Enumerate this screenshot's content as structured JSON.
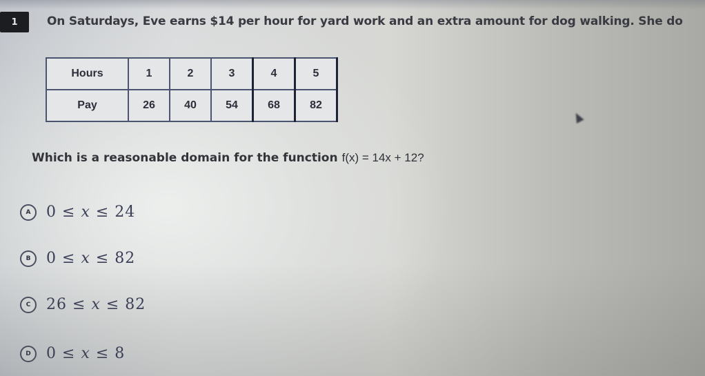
{
  "question": {
    "number": "1",
    "prompt": "On Saturdays, Eve earns $14 per hour for yard work and an extra amount for dog walking. She do",
    "question_text": "Which is a reasonable domain for the function",
    "function_text": "f(x) = 14x + 12?"
  },
  "table": {
    "rows": [
      {
        "label": "Hours",
        "values": [
          "1",
          "2",
          "3",
          "4",
          "5"
        ]
      },
      {
        "label": "Pay",
        "values": [
          "26",
          "40",
          "54",
          "68",
          "82"
        ]
      }
    ]
  },
  "choices": [
    {
      "letter": "A",
      "lower": "0",
      "variable": "x",
      "upper": "24"
    },
    {
      "letter": "B",
      "lower": "0",
      "variable": "x",
      "upper": "82"
    },
    {
      "letter": "C",
      "lower": "26",
      "variable": "x",
      "upper": "82"
    },
    {
      "letter": "D",
      "lower": "0",
      "variable": "x",
      "upper": "8"
    }
  ],
  "symbols": {
    "leq": "≤"
  }
}
